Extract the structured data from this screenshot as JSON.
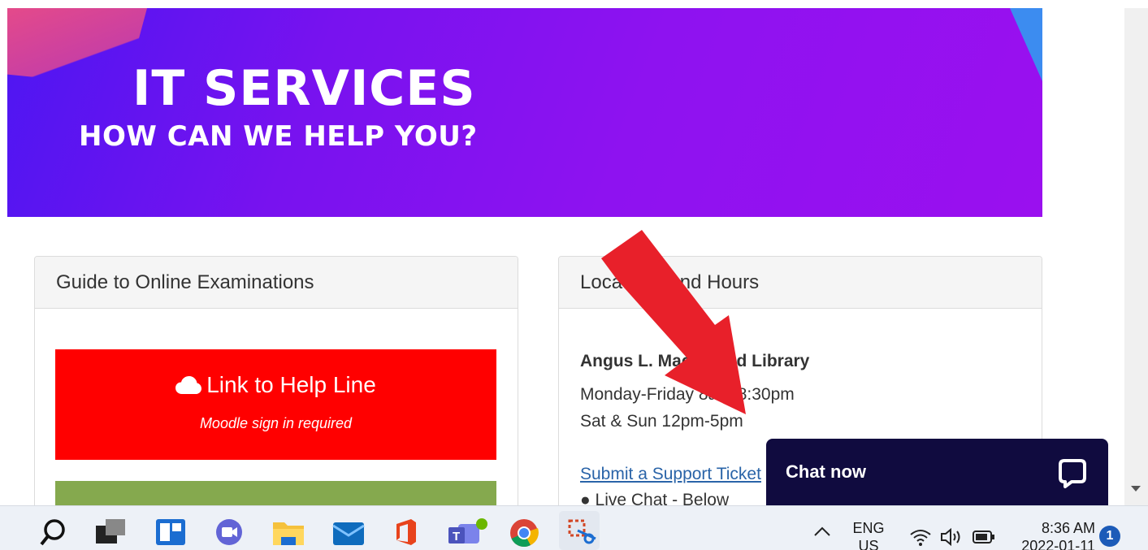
{
  "banner": {
    "title": "IT SERVICES",
    "subtitle": "HOW CAN WE HELP YOU?"
  },
  "exam_panel": {
    "heading": "Guide to Online Examinations",
    "help_button": {
      "label": "Link to Help Line",
      "sublabel": "Moodle sign in required",
      "icon": "cloud-icon",
      "color": "#ff0000"
    }
  },
  "location_panel": {
    "heading": "Locations and Hours",
    "library_name": "Angus L. Macdonald Library",
    "hours_weekday": "Monday-Friday 8am-8:30pm",
    "hours_weekend": "Sat & Sun 12pm-5pm",
    "support_link": "Submit a Support Ticket",
    "live_chat": "Live Chat - Below"
  },
  "chat_widget": {
    "label": "Chat now",
    "icon": "chat-bubble-icon"
  },
  "taskbar": {
    "language_top": "ENG",
    "language_bottom": "US",
    "time": "8:36 AM",
    "date": "2022-01-11",
    "notification_count": "1"
  }
}
